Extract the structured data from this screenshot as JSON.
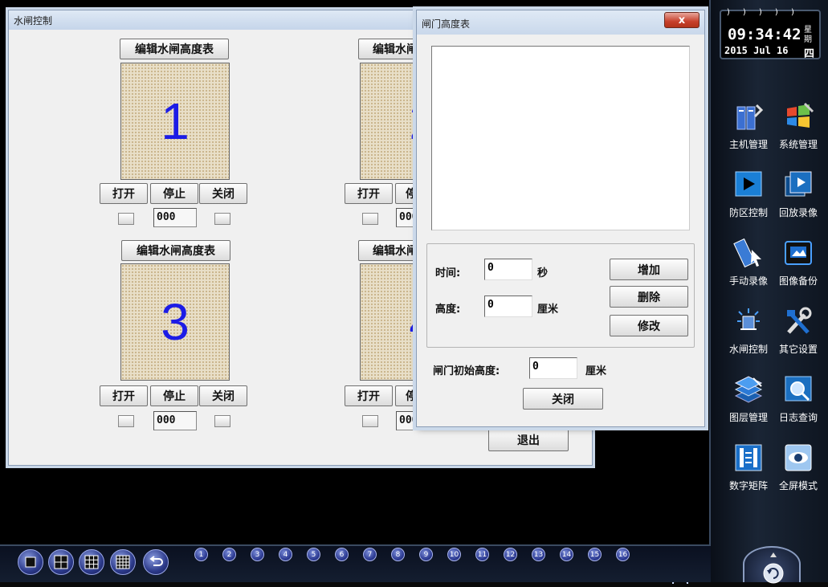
{
  "sluice_window": {
    "title": "水闸控制",
    "edit_label": "编辑水闸高度表",
    "edit_label_partial": "编辑水闸",
    "open_label": "打开",
    "stop_label": "停止",
    "stop_label_partial": "停",
    "close_label": "关闭",
    "gates": [
      {
        "number": "1",
        "value": "000"
      },
      {
        "number": "2",
        "value": "000"
      },
      {
        "number": "3",
        "value": "000"
      },
      {
        "number": "4",
        "value": "000"
      }
    ],
    "exit_label": "退出"
  },
  "dialog": {
    "title": "闸门高度表",
    "close_x": "x",
    "time_label": "时间:",
    "time_value": "0",
    "time_unit": "秒",
    "height_label": "高度:",
    "height_value": "0",
    "height_unit": "厘米",
    "add_label": "增加",
    "delete_label": "删除",
    "modify_label": "修改",
    "initial_height_label": "闸门初始高度:",
    "initial_height_value": "0",
    "initial_height_unit": "厘米",
    "close_label": "关闭"
  },
  "clock": {
    "time": "09:34:42",
    "date": "2015 Jul 16",
    "weekday_prefix_1": "星",
    "weekday_prefix_2": "期",
    "weekday": "四"
  },
  "sidebar": {
    "items": [
      {
        "label": "主机管理",
        "icon": "host-icon"
      },
      {
        "label": "系统管理",
        "icon": "windows-icon"
      },
      {
        "label": "防区控制",
        "icon": "play-zone-icon"
      },
      {
        "label": "回放录像",
        "icon": "playback-icon"
      },
      {
        "label": "手动录像",
        "icon": "film-cursor-icon"
      },
      {
        "label": "图像备份",
        "icon": "image-backup-icon"
      },
      {
        "label": "水闸控制",
        "icon": "sluice-icon"
      },
      {
        "label": "其它设置",
        "icon": "tools-icon"
      },
      {
        "label": "图层管理",
        "icon": "layers-icon"
      },
      {
        "label": "日志查询",
        "icon": "log-search-icon"
      },
      {
        "label": "数字矩阵",
        "icon": "matrix-icon"
      },
      {
        "label": "全屏模式",
        "icon": "eye-icon"
      }
    ]
  },
  "bottom_bar": {
    "view_buttons": [
      "view-1-icon",
      "view-4-icon",
      "view-9-icon",
      "view-16-icon",
      "back-icon"
    ],
    "channels": [
      "1",
      "2",
      "3",
      "4",
      "5",
      "6",
      "7",
      "8",
      "9",
      "10",
      "11",
      "12",
      "13",
      "14",
      "15",
      "16"
    ]
  },
  "colors": {
    "gate_number": "#1c1ce6",
    "sidebar_bg": "#1a2535",
    "window_bg": "#f0f0f0"
  }
}
